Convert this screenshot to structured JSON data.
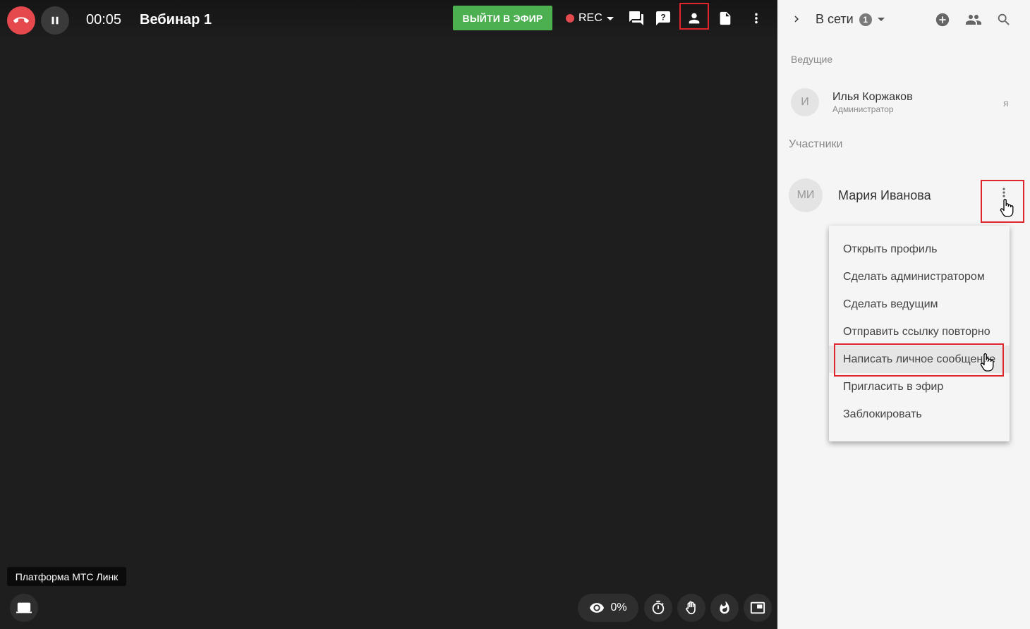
{
  "header": {
    "timer": "00:05",
    "title": "Вебинар 1",
    "go_live_label": "ВЫЙТИ В ЭФИР",
    "rec_label": "REC"
  },
  "toolbar_icons": [
    "hangup-icon",
    "pause-icon",
    "chat-icon",
    "question-icon",
    "person-icon",
    "document-icon",
    "more-vert-icon"
  ],
  "bottom": {
    "tooltip": "Платформа МТС Линк",
    "viewers_percent": "0%",
    "icons": [
      "screen-icon",
      "eye-icon",
      "timer-icon",
      "hand-icon",
      "fire-icon",
      "pip-icon"
    ]
  },
  "panel": {
    "online_label": "В сети",
    "online_count": "1",
    "hosts_label": "Ведущие",
    "host": {
      "initials": "И",
      "name": "Илья Коржаков",
      "role": "Администратор",
      "me": "я"
    },
    "participants_label": "Участники",
    "participant": {
      "initials": "МИ",
      "name": "Мария Иванова"
    }
  },
  "context_menu": {
    "items": [
      "Открыть профиль",
      "Сделать администратором",
      "Сделать ведущим",
      "Отправить ссылку повторно",
      "Написать личное сообщение",
      "Пригласить в эфир",
      "Заблокировать"
    ],
    "highlighted_index": 4
  },
  "colors": {
    "accent_green": "#4caf50",
    "hangup_red": "#e5484d",
    "highlight_red": "#e0262c",
    "stage_bg": "#1e1e1e",
    "panel_bg": "#f5f5f5"
  }
}
